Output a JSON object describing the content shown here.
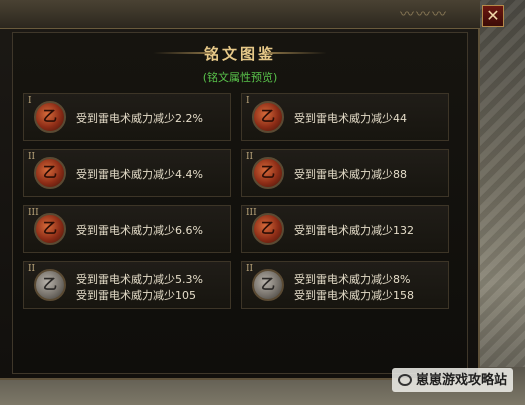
{
  "window": {
    "title": "铭文图鉴",
    "subtitle": "(铭文属性预览)",
    "close_label": "✕"
  },
  "cards": [
    {
      "tier": "I",
      "rune_color": "red",
      "lines": [
        "受到雷电术威力减少2.2%"
      ]
    },
    {
      "tier": "I",
      "rune_color": "red",
      "lines": [
        "受到雷电术威力减少44"
      ]
    },
    {
      "tier": "II",
      "rune_color": "red",
      "lines": [
        "受到雷电术威力减少4.4%"
      ]
    },
    {
      "tier": "II",
      "rune_color": "red",
      "lines": [
        "受到雷电术威力减少88"
      ]
    },
    {
      "tier": "III",
      "rune_color": "red",
      "lines": [
        "受到雷电术威力减少6.6%"
      ]
    },
    {
      "tier": "III",
      "rune_color": "red",
      "lines": [
        "受到雷电术威力减少132"
      ]
    },
    {
      "tier": "II",
      "rune_color": "grey",
      "lines": [
        "受到雷电术威力减少5.3%",
        "受到雷电术威力减少105"
      ]
    },
    {
      "tier": "II",
      "rune_color": "grey",
      "lines": [
        "受到雷电术威力减少8%",
        "受到雷电术威力减少158"
      ]
    }
  ],
  "watermark": "崽崽游戏攻略站",
  "colors": {
    "title": "#e6c888",
    "subtitle": "#58c24a",
    "text": "#e4dcc8",
    "rune_red": "#b8431f",
    "rune_grey": "#8a867e"
  }
}
